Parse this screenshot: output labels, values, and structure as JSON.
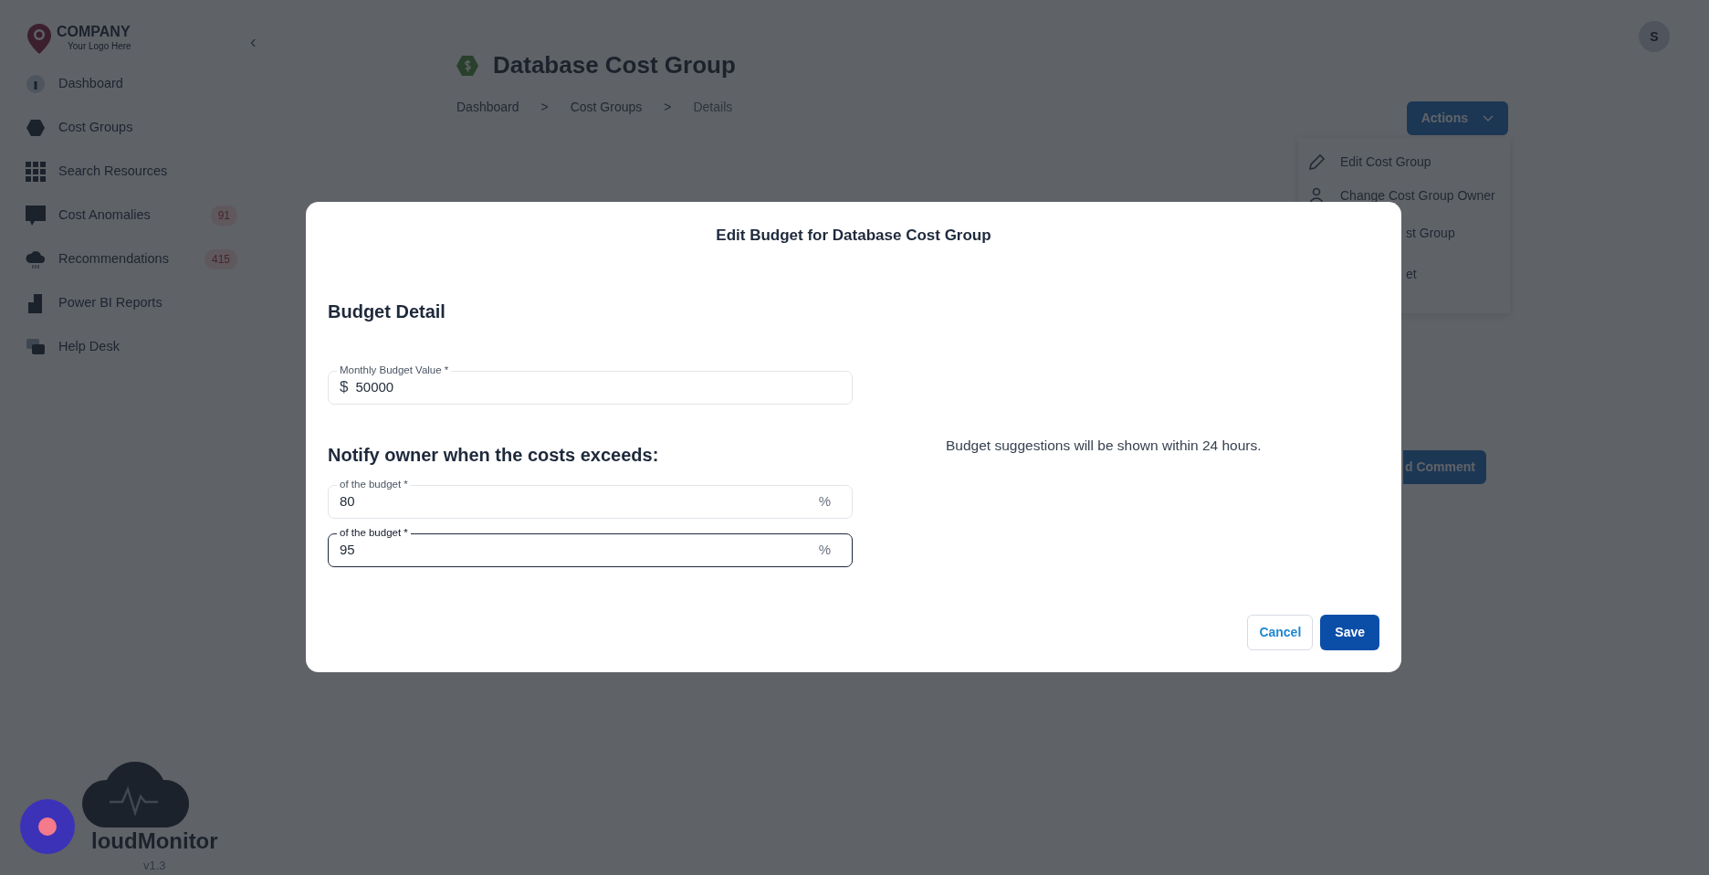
{
  "sidebar": {
    "logo": {
      "name": "COMPANY",
      "tagline": "Your Logo Here"
    },
    "collapse_glyph": "‹",
    "items": [
      {
        "label": "Dashboard"
      },
      {
        "label": "Cost Groups"
      },
      {
        "label": "Search Resources"
      },
      {
        "label": "Cost Anomalies",
        "badge": "91"
      },
      {
        "label": "Recommendations",
        "badge": "415"
      },
      {
        "label": "Power BI Reports"
      },
      {
        "label": "Help Desk"
      }
    ],
    "brand": {
      "name": "loudMonitor",
      "version": "v1.3"
    }
  },
  "header": {
    "avatar": "S",
    "title": "Database Cost Group",
    "breadcrumb": [
      {
        "label": "Dashboard",
        "kind": "link"
      },
      {
        "label": ">",
        "kind": "sep"
      },
      {
        "label": "Cost Groups",
        "kind": "link"
      },
      {
        "label": ">",
        "kind": "sep"
      },
      {
        "label": "Details",
        "kind": "current"
      }
    ],
    "actions": {
      "label": "Actions",
      "menu": [
        {
          "label": "Edit Cost Group",
          "kind": "full"
        },
        {
          "label": "Change Cost Group Owner",
          "kind": "full"
        },
        {
          "label": "st Group",
          "kind": "partial"
        },
        {
          "label": "et",
          "kind": "partial"
        }
      ]
    }
  },
  "add_comment_button": "d Comment",
  "modal": {
    "title": "Edit Budget for Database Cost Group",
    "section_title": "Budget Detail",
    "notify_title": "Notify owner when the costs exceeds:",
    "fields": [
      {
        "label": "Monthly Budget Value *",
        "prefix": "$",
        "value": "50000",
        "focused": false
      },
      {
        "label": "of the budget *",
        "value": "80",
        "suffix": "%",
        "focused": false
      },
      {
        "label": "of the budget *",
        "value": "95",
        "suffix": "%",
        "focused": true
      }
    ],
    "note": "Budget suggestions will be shown within 24 hours.",
    "buttons": [
      {
        "label": "Cancel",
        "kind": "secondary"
      },
      {
        "label": "Save",
        "kind": "primary"
      }
    ]
  }
}
